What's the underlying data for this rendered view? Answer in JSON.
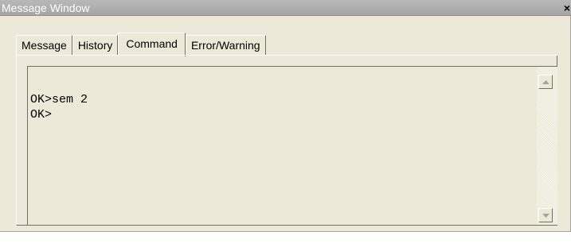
{
  "window": {
    "title": "Message Window",
    "close_symbol": "×"
  },
  "tabs": [
    {
      "label": "Message",
      "active": false
    },
    {
      "label": "History",
      "active": false
    },
    {
      "label": "Command",
      "active": true
    },
    {
      "label": "Error/Warning",
      "active": false
    }
  ],
  "output": {
    "lines": [
      "OK>sem 2",
      "OK>"
    ]
  },
  "scrollbar": {
    "up_icon": "arrow-up-icon",
    "down_icon": "arrow-down-icon"
  }
}
